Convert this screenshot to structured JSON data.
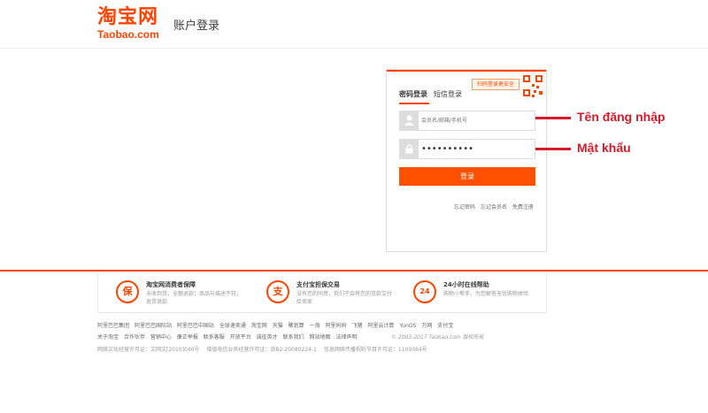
{
  "header": {
    "logo_cn": "淘宝网",
    "logo_en": "Taobao.com",
    "title": "账户登录"
  },
  "login": {
    "qr_tip": "扫码登录更安全",
    "tabs": [
      {
        "label": "密码登录",
        "active": true
      },
      {
        "label": "短信登录",
        "active": false
      }
    ],
    "username_placeholder": "会员名/邮箱/手机号",
    "password_value": "••••••••••",
    "login_label": "登录",
    "links": [
      "忘记密码",
      "忘记会员名",
      "免费注册"
    ]
  },
  "annotations": {
    "username": "Tên đăng nhập",
    "password": "Mật khẩu"
  },
  "services": [
    {
      "icon": "保",
      "title": "淘宝网消费者保障",
      "desc": "未收到货，全额退款；商品与描述不符，退货退款"
    },
    {
      "icon": "支",
      "title": "支付宝担保交易",
      "desc": "没有您的同意，我们不会将您的货款交付给卖家"
    },
    {
      "icon": "24",
      "title": "24小时在线帮助",
      "desc": "购物小帮手，为您解答无忧购物体验"
    }
  ],
  "footer": {
    "row1": [
      "阿里巴巴集团",
      "阿里巴巴国际站",
      "阿里巴巴中国站",
      "全球速卖通",
      "淘宝网",
      "天猫",
      "聚划算",
      "一淘",
      "阿里妈妈",
      "飞猪",
      "阿里云计算",
      "YunOS",
      "万网",
      "支付宝"
    ],
    "row2": [
      "关于淘宝",
      "合作伙伴",
      "营销中心",
      "廉正举报",
      "联系客服",
      "开放平台",
      "诚征英才",
      "联系我们",
      "网站地图",
      "法律声明"
    ],
    "copyright": "© 2003-2017 Taobao.com 版权所有",
    "license": [
      "网络文化经营许可证：文网文[2010]040号",
      "增值电信业务经营许可证：浙B2-20080224-1",
      "信息网络传播视听节目许可证：1109364号"
    ]
  },
  "colors": {
    "brand": "#ff4400",
    "annotation": "#d8192a"
  }
}
